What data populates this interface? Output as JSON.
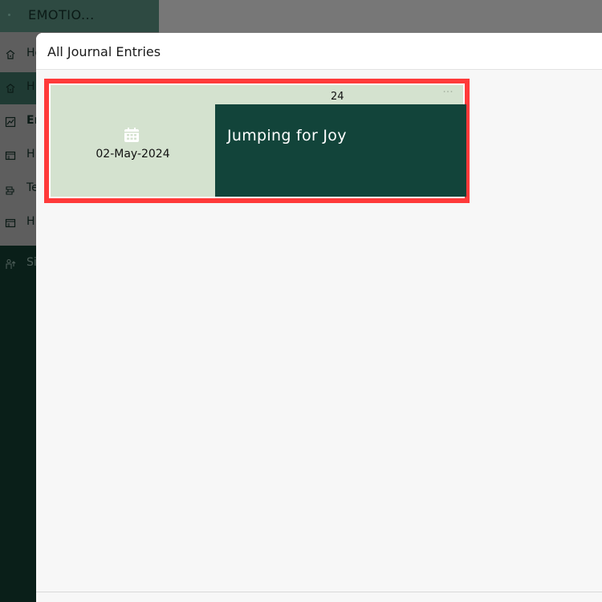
{
  "app": {
    "title": "EMOTIO..."
  },
  "sidebar": {
    "items": [
      {
        "label": "Ho",
        "icon": "home-icon"
      },
      {
        "label": "H",
        "icon": "home-icon"
      },
      {
        "label": "En",
        "icon": "chart-icon"
      },
      {
        "label": "H",
        "icon": "card-icon"
      },
      {
        "label": "Te",
        "icon": "cash-icon"
      },
      {
        "label": "H",
        "icon": "card-icon"
      },
      {
        "label": "Sig",
        "icon": "sign-out-icon"
      }
    ]
  },
  "modal": {
    "title": "All Journal Entries"
  },
  "entry": {
    "count": "24",
    "menu": "···",
    "heading": "Jumping for Joy",
    "date": "02-May-2024",
    "calendar_icon": "calendar-icon"
  },
  "colors": {
    "accent_dark": "#12443a",
    "card_light": "#d4e2cf",
    "highlight": "#ff3a3a"
  }
}
